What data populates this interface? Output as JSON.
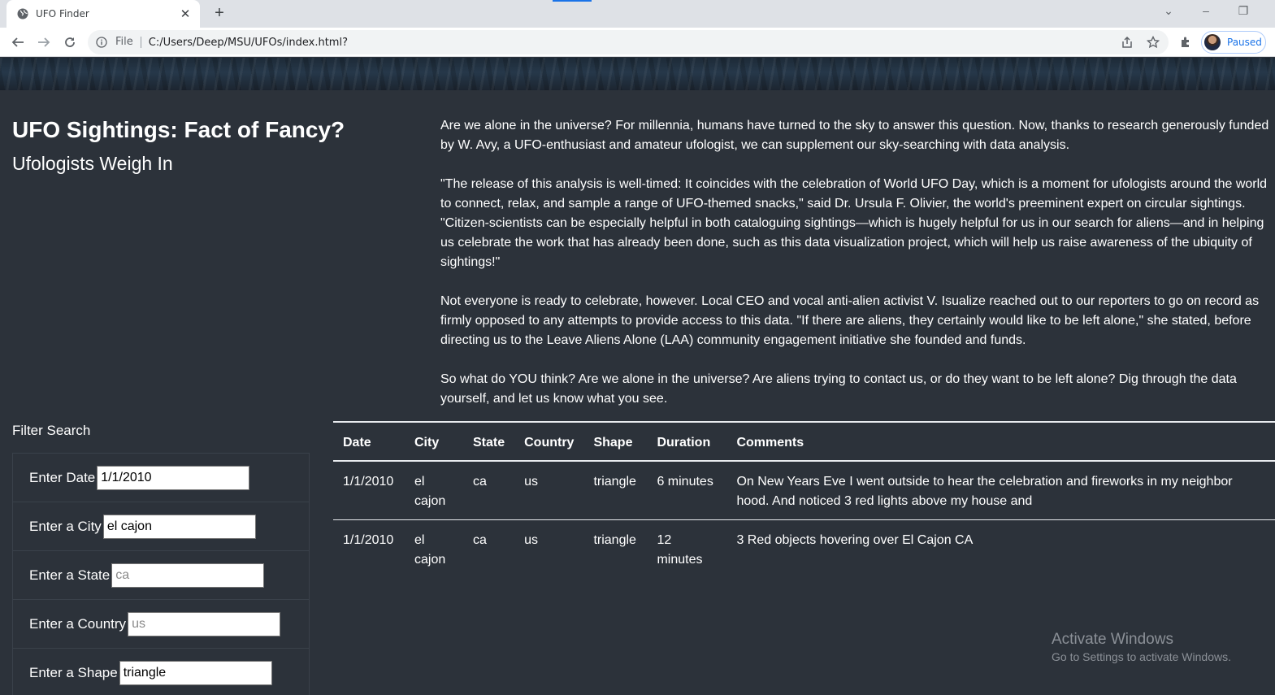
{
  "browser": {
    "tab_title": "UFO Finder",
    "url_scheme": "File",
    "url": "C:/Users/Deep/MSU/UFOs/index.html?",
    "profile_label": "Paused"
  },
  "page": {
    "title_main": "UFO Sightings: Fact of Fancy?",
    "title_sub": "Ufologists Weigh In",
    "paragraphs": [
      "Are we alone in the universe? For millennia, humans have turned to the sky to answer this question. Now, thanks to research generously funded by W. Avy, a UFO-enthusiast and amateur ufologist, we can supplement our sky-searching with data analysis.",
      "\"The release of this analysis is well-timed: It coincides with the celebration of World UFO Day, which is a moment for ufologists around the world to connect, relax, and sample a range of UFO-themed snacks,\" said Dr. Ursula F. Olivier, the world's preeminent expert on circular sightings. \"Citizen-scientists can be especially helpful in both cataloguing sightings—which is hugely helpful for us in our search for aliens—and in helping us celebrate the work that has already been done, such as this data visualization project, which will help us raise awareness of the ubiquity of sightings!\"",
      "Not everyone is ready to celebrate, however. Local CEO and vocal anti-alien activist V. Isualize reached out to our reporters to go on record as firmly opposed to any attempts to provide access to this data. \"If there are aliens, they certainly would like to be left alone,\" she stated, before directing us to the Leave Aliens Alone (LAA) community engagement initiative she founded and funds.",
      "So what do YOU think? Are we alone in the universe? Are aliens trying to contact us, or do they want to be left alone? Dig through the data yourself, and let us know what you see."
    ]
  },
  "filters": {
    "title": "Filter Search",
    "date": {
      "label": "Enter Date",
      "value": "1/1/2010",
      "placeholder": ""
    },
    "city": {
      "label": "Enter a City",
      "value": "el cajon",
      "placeholder": ""
    },
    "state": {
      "label": "Enter a State",
      "value": "",
      "placeholder": "ca"
    },
    "country": {
      "label": "Enter a Country",
      "value": "",
      "placeholder": "us"
    },
    "shape": {
      "label": "Enter a Shape",
      "value": "triangle",
      "placeholder": ""
    }
  },
  "table": {
    "headers": [
      "Date",
      "City",
      "State",
      "Country",
      "Shape",
      "Duration",
      "Comments"
    ],
    "rows": [
      [
        "1/1/2010",
        "el cajon",
        "ca",
        "us",
        "triangle",
        "6 minutes",
        "On New Years Eve I went outside to hear the celebration and fireworks in my neighbor hood. And noticed 3 red lights above my house and"
      ],
      [
        "1/1/2010",
        "el cajon",
        "ca",
        "us",
        "triangle",
        "12 minutes",
        "3 Red objects hovering over El Cajon CA"
      ]
    ]
  },
  "watermark": {
    "line1": "Activate Windows",
    "line2": "Go to Settings to activate Windows."
  }
}
